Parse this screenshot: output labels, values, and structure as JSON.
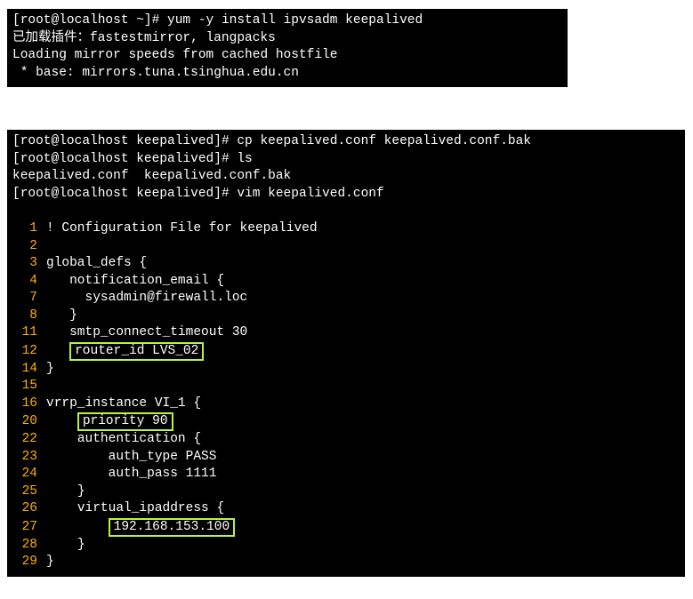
{
  "term1": {
    "lines": [
      "[root@localhost ~]# yum -y install ipvsadm keepalived",
      "已加载插件：fastestmirror, langpacks",
      "Loading mirror speeds from cached hostfile",
      " * base: mirrors.tuna.tsinghua.edu.cn"
    ]
  },
  "term2": {
    "pre": [
      "[root@localhost keepalived]# cp keepalived.conf keepalived.conf.bak",
      "[root@localhost keepalived]# ls",
      "keepalived.conf  keepalived.conf.bak",
      "[root@localhost keepalived]# vim keepalived.conf"
    ],
    "file": [
      {
        "n": "1",
        "t": "! Configuration File for keepalived",
        "hl": false,
        "indent": ""
      },
      {
        "n": "2",
        "t": "",
        "hl": false,
        "indent": ""
      },
      {
        "n": "3",
        "t": "global_defs {",
        "hl": false,
        "indent": ""
      },
      {
        "n": "4",
        "t": "notification_email {",
        "hl": false,
        "indent": "   "
      },
      {
        "n": "7",
        "t": "sysadmin@firewall.loc",
        "hl": false,
        "indent": "     "
      },
      {
        "n": "8",
        "t": "}",
        "hl": false,
        "indent": "   "
      },
      {
        "n": "11",
        "t": "smtp_connect_timeout 30",
        "hl": false,
        "indent": "   "
      },
      {
        "n": "12",
        "t": "router_id LVS_02",
        "hl": true,
        "indent": "   "
      },
      {
        "n": "14",
        "t": "}",
        "hl": false,
        "indent": ""
      },
      {
        "n": "15",
        "t": "",
        "hl": false,
        "indent": ""
      },
      {
        "n": "16",
        "t": "vrrp_instance VI_1 {",
        "hl": false,
        "indent": ""
      },
      {
        "n": "20",
        "t": "priority 90",
        "hl": true,
        "indent": "    "
      },
      {
        "n": "22",
        "t": "authentication {",
        "hl": false,
        "indent": "    "
      },
      {
        "n": "23",
        "t": "auth_type PASS",
        "hl": false,
        "indent": "        "
      },
      {
        "n": "24",
        "t": "auth_pass 1111",
        "hl": false,
        "indent": "        "
      },
      {
        "n": "25",
        "t": "}",
        "hl": false,
        "indent": "    "
      },
      {
        "n": "26",
        "t": "virtual_ipaddress {",
        "hl": false,
        "indent": "    "
      },
      {
        "n": "27",
        "t": "192.168.153.100",
        "hl": true,
        "indent": "        "
      },
      {
        "n": "28",
        "t": "}",
        "hl": false,
        "indent": "    "
      },
      {
        "n": "29",
        "t": "}",
        "hl": false,
        "indent": ""
      }
    ]
  }
}
